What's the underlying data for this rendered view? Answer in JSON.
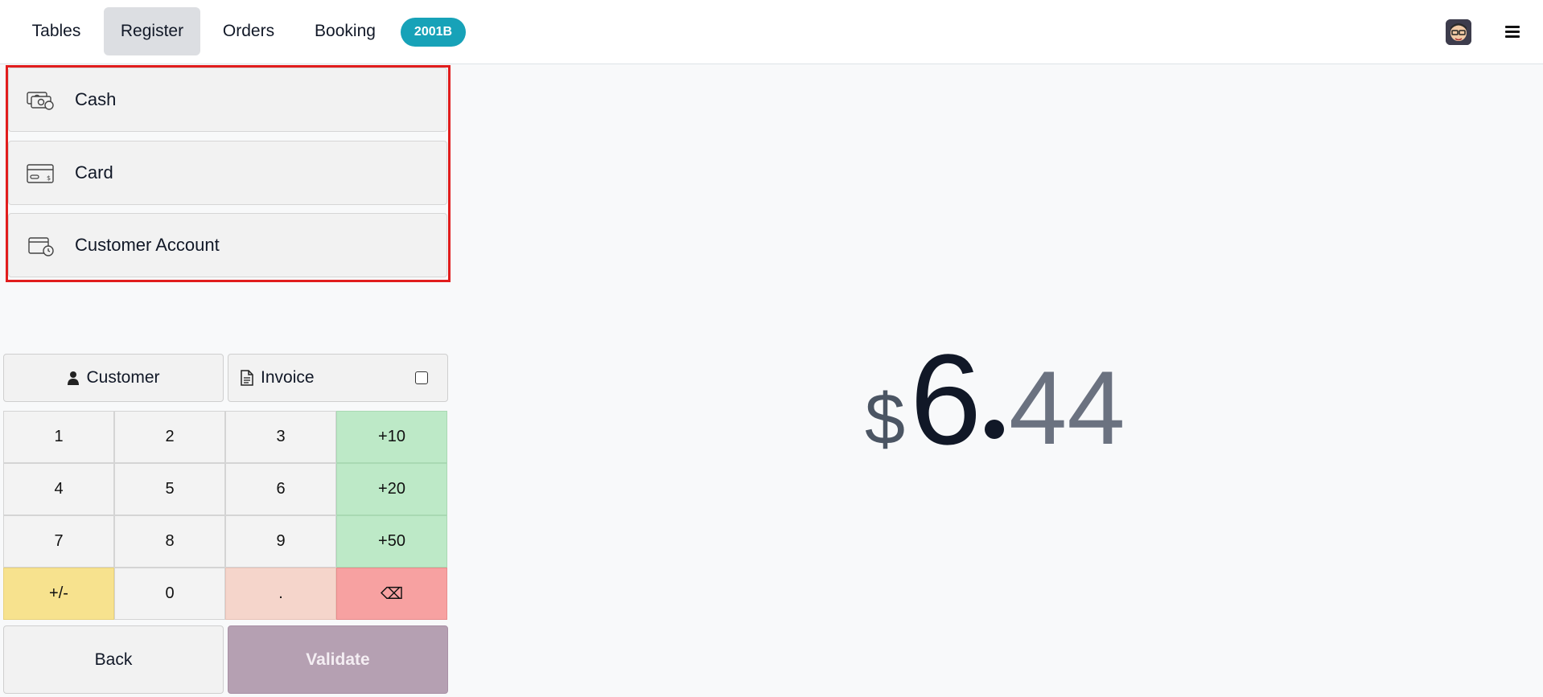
{
  "nav": {
    "tabs": [
      {
        "label": "Tables",
        "active": false
      },
      {
        "label": "Register",
        "active": true
      },
      {
        "label": "Orders",
        "active": false
      },
      {
        "label": "Booking",
        "active": false
      }
    ],
    "order_badge": "2001B",
    "avatar_icon": "user-avatar-icon",
    "menu_icon": "hamburger-menu-icon"
  },
  "payment_methods": [
    {
      "label": "Cash",
      "icon": "cash-icon"
    },
    {
      "label": "Card",
      "icon": "card-icon"
    },
    {
      "label": "Customer Account",
      "icon": "wallet-clock-icon"
    }
  ],
  "actions": {
    "customer_label": "Customer",
    "invoice_label": "Invoice",
    "invoice_checked": false
  },
  "numpad": {
    "rows": [
      [
        "1",
        "2",
        "3",
        "+10"
      ],
      [
        "4",
        "5",
        "6",
        "+20"
      ],
      [
        "7",
        "8",
        "9",
        "+50"
      ],
      [
        "+/-",
        "0",
        ".",
        "⌫"
      ]
    ]
  },
  "footer": {
    "back_label": "Back",
    "validate_label": "Validate"
  },
  "amount": {
    "currency": "$",
    "integer": "6",
    "decimal": "44"
  },
  "colors": {
    "badge": "#17a2b8",
    "highlight_border": "#e11d1d",
    "quick_add": "#bde9c7",
    "sign": "#f7e28e",
    "dot": "#f5d5cb",
    "backspace": "#f7a1a1",
    "validate": "#b5a0b2"
  }
}
